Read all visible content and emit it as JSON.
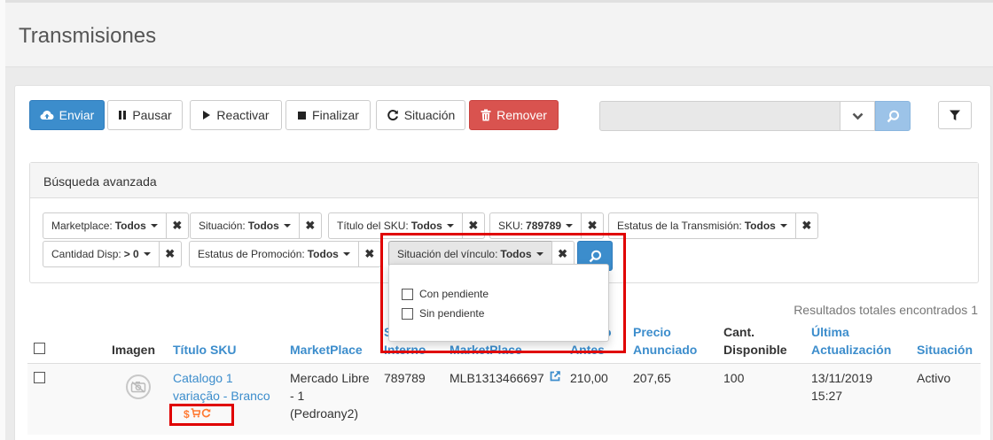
{
  "page": {
    "title": "Transmisiones"
  },
  "toolbar": {
    "send": "Enviar",
    "pause": "Pausar",
    "reactivate": "Reactivar",
    "finish": "Finalizar",
    "situation": "Situación",
    "remove": "Remover"
  },
  "advanced_search": {
    "title": "Búsqueda avanzada",
    "filters": [
      {
        "label": "Marketplace:",
        "value": "Todos"
      },
      {
        "label": "Situación:",
        "value": "Todos"
      },
      {
        "label": "Título del SKU:",
        "value": "Todos"
      },
      {
        "label": "SKU:",
        "value": "789789"
      },
      {
        "label": "Estatus de la Transmisión:",
        "value": "Todos"
      },
      {
        "label": "Cantidad Disp:",
        "value": "> 0"
      },
      {
        "label": "Estatus de Promoción:",
        "value": "Todos"
      },
      {
        "label": "Situación del vínculo:",
        "value": "Todos"
      }
    ],
    "dropdown_options": [
      "Con pendiente",
      "Sin pendiente"
    ]
  },
  "results_text": "Resultados totales encontrados 1",
  "table": {
    "headers": {
      "image": "Imagen",
      "title_sku": "Título SKU",
      "marketplace": "MarketPlace",
      "sku_internal": [
        "S",
        "Interno"
      ],
      "marketplace_id": "MarketPlace",
      "price_before": [
        "o",
        "Antes"
      ],
      "price_listed": [
        "Precio",
        "Anunciado"
      ],
      "qty_available": [
        "Cant.",
        "Disponible"
      ],
      "last_update": [
        "Última",
        "Actualización"
      ],
      "situation": "Situación"
    },
    "rows": [
      {
        "title": [
          "Catalogo 1",
          "variação - Branco"
        ],
        "marketplace": [
          "Mercado Libre",
          "- 1",
          "(Pedroany2)"
        ],
        "sku": "789789",
        "marketplace_id": "MLB1313466697",
        "price_before": "210,00",
        "price_listed": "207,65",
        "qty": "100",
        "last_update": [
          "13/11/2019",
          "15:27"
        ],
        "status": "Activo"
      }
    ]
  },
  "colors": {
    "primary": "#3c8dcc",
    "danger": "#d9534f",
    "highlight": "#e00000",
    "link": "#3c8dcc",
    "icon_orange": "#ff7a33"
  }
}
